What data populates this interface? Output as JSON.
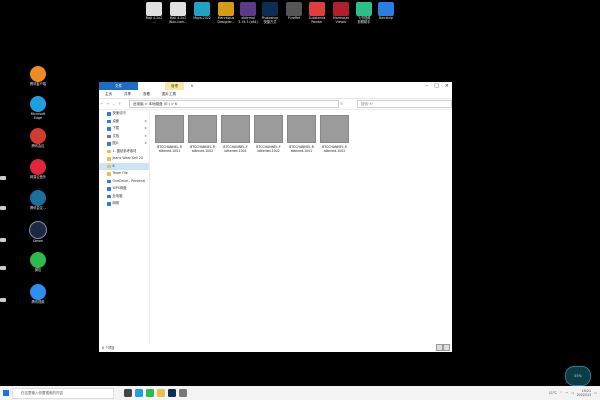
{
  "top_icons": [
    {
      "label": "Mail 4.2x2\n...",
      "color": "#e0e0e0"
    },
    {
      "label": "Mail 4.2x2\n(Non-com...",
      "color": "#e0e0e0"
    },
    {
      "label": "Moyo.2022",
      "color": "#1fa2c6"
    },
    {
      "label": "Marvelous\nDesigner...",
      "color": "#d49b18"
    },
    {
      "label": "xNormal\n3.19.3 (x64)",
      "color": "#5b3a86"
    },
    {
      "label": "Photoshop\n快捷方式",
      "color": "#0b2e57"
    },
    {
      "label": "PureRef",
      "color": "#555555"
    },
    {
      "label": "Substance\nPainter",
      "color": "#e23d3d"
    },
    {
      "label": "Marmoset\nViewer",
      "color": "#b01f2c"
    },
    {
      "label": "飞书视频\n剪辑助手",
      "color": "#2bbf8a"
    },
    {
      "label": "Bandizip",
      "color": "#2a7ee0"
    }
  ],
  "left_icons": [
    {
      "label": "腾讯客户端",
      "color": "#f08a24"
    },
    {
      "label": "Microsoft\nEdge",
      "color": "#1f9fe0"
    },
    {
      "label": "腾讯会议",
      "color": "#d23c2c"
    },
    {
      "label": "网易云音乐",
      "color": "#e0263a"
    },
    {
      "label": "腾讯会议...",
      "color": "#1a6f9f"
    },
    {
      "label": "Steam",
      "color": "#1b2a44"
    },
    {
      "label": "微信",
      "color": "#2dba4e"
    },
    {
      "label": "腾讯视频",
      "color": "#2d8ff0"
    }
  ],
  "explorer": {
    "title_tab": "管理",
    "title_path": "K",
    "ribbon": [
      "文件",
      "主页",
      "共享",
      "查看",
      "图片工具"
    ],
    "address": "此电脑 > 本地磁盘 (E:) > K",
    "search_placeholder": "搜索\"K\"",
    "nav": [
      {
        "label": "快速访问",
        "color": "#2a7ee0"
      },
      {
        "label": "桌面",
        "color": "#2a7ee0",
        "pinned": true
      },
      {
        "label": "下载",
        "color": "#2a7ee0",
        "pinned": true
      },
      {
        "label": "文档",
        "color": "#777777",
        "pinned": true
      },
      {
        "label": "图片",
        "color": "#2a7ee0",
        "pinned": true
      },
      {
        "label": "1. 图纸参考素材",
        "color": "#e8c04a"
      },
      {
        "label": "Jeans Wear Sell 20",
        "color": "#e8c04a"
      },
      {
        "label": "K",
        "color": "#e8c04a"
      },
      {
        "label": "Team File",
        "color": "#e8c04a"
      },
      {
        "label": "OneDrive - Personal",
        "color": "#2a7ee0"
      },
      {
        "label": "WPS网盘",
        "color": "#2a7ee0"
      },
      {
        "label": "此电脑",
        "color": "#2a7ee0"
      },
      {
        "label": "网络",
        "color": "#2a7ee0"
      }
    ],
    "files": [
      {
        "name": "BTCCHANNEL-R\nattened.1001"
      },
      {
        "name": "BTCCHANNEL-R\nattened.1002"
      },
      {
        "name": "BTCCHANNEL-F\nlattened.1001"
      },
      {
        "name": "BTCCHANNEL-F\nlattened.1002"
      },
      {
        "name": "BTCCHANNEL-R\nattened.1001"
      },
      {
        "name": "BTCCHANNEL-R\nattened.1002"
      }
    ],
    "status": "6 个项目"
  },
  "taskbar": {
    "search_placeholder": "在这里输入你要搜索的内容",
    "weather": "11°C",
    "time": "19:21",
    "date": "2022/1/3"
  },
  "weather_widget": "55%"
}
